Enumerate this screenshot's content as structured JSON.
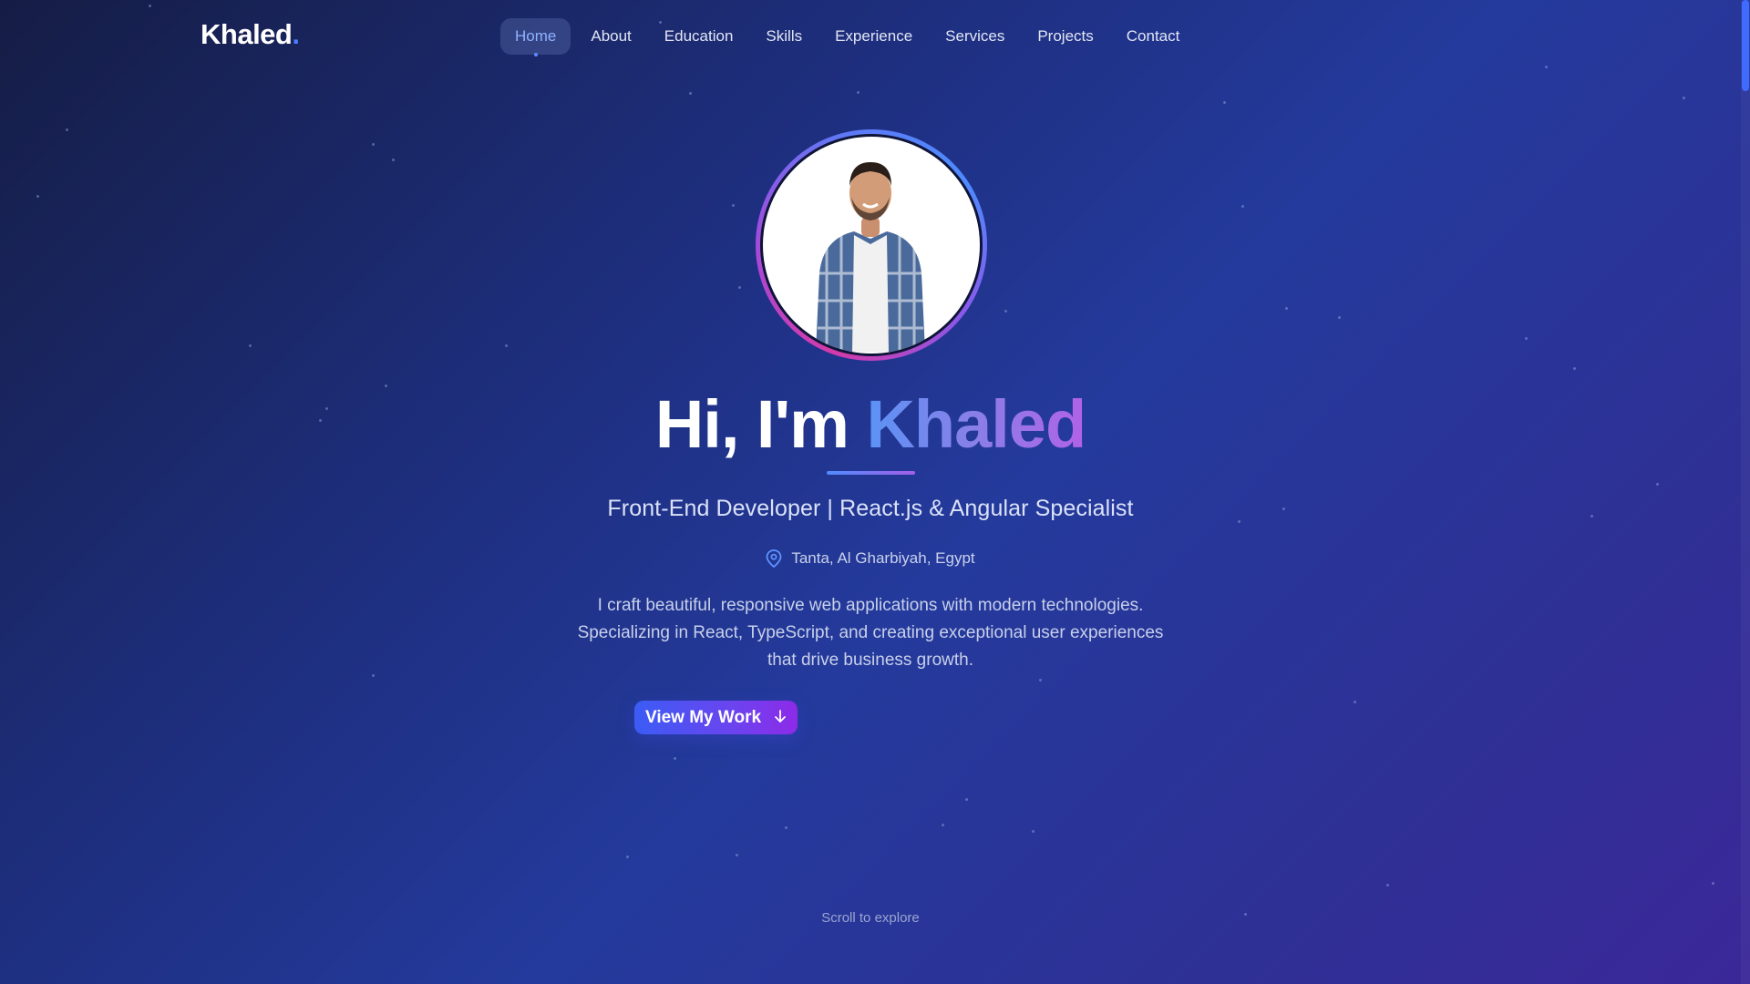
{
  "brand": {
    "name": "Khaled",
    "dot": ".",
    "accent_color": "#4c7dff"
  },
  "nav": {
    "items": [
      {
        "label": "Home",
        "active": true
      },
      {
        "label": "About"
      },
      {
        "label": "Education"
      },
      {
        "label": "Skills"
      },
      {
        "label": "Experience"
      },
      {
        "label": "Services"
      },
      {
        "label": "Projects"
      },
      {
        "label": "Contact"
      }
    ]
  },
  "hero": {
    "greeting": "Hi, I'm ",
    "name": "Khaled",
    "subtitle": "Front-End Developer | React.js & Angular Specialist",
    "location": {
      "icon": "map-pin-icon",
      "text": "Tanta, Al Gharbiyah, Egypt"
    },
    "description": "I craft beautiful, responsive web applications with modern technologies. Specializing in React, TypeScript, and creating exceptional user experiences that drive business growth.",
    "cta": {
      "label": "View My Work",
      "icon": "arrow-down-icon"
    },
    "scroll_hint": "Scroll to explore"
  },
  "colors": {
    "gradient_start": "#151d45",
    "gradient_end": "#3b2898",
    "name_gradient_start": "#5a93f5",
    "name_gradient_end": "#b162e6",
    "button_start": "#3b5cf5",
    "button_end": "#8d2ae8"
  }
}
